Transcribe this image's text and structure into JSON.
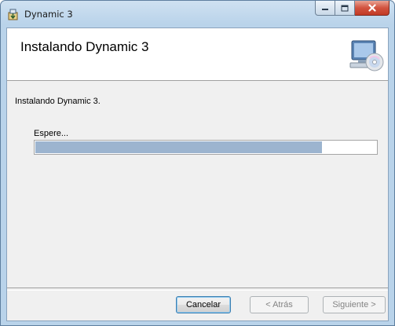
{
  "window": {
    "title": "Dynamic 3"
  },
  "caption_buttons": [
    "minimize-icon",
    "maximize-icon",
    "close-icon"
  ],
  "header": {
    "title": "Instalando Dynamic 3",
    "icon": "computer-disc-icon"
  },
  "status_text": "Instalando Dynamic 3.",
  "progress": {
    "label": "Espere...",
    "fraction": 0.84,
    "color": "#9cb4cf"
  },
  "buttons": {
    "cancel": "Cancelar",
    "back": "< Atrás",
    "next": "Siguiente >"
  },
  "colors": {
    "accent_border": "#3c7fb1",
    "close_red": "#c23a25"
  }
}
